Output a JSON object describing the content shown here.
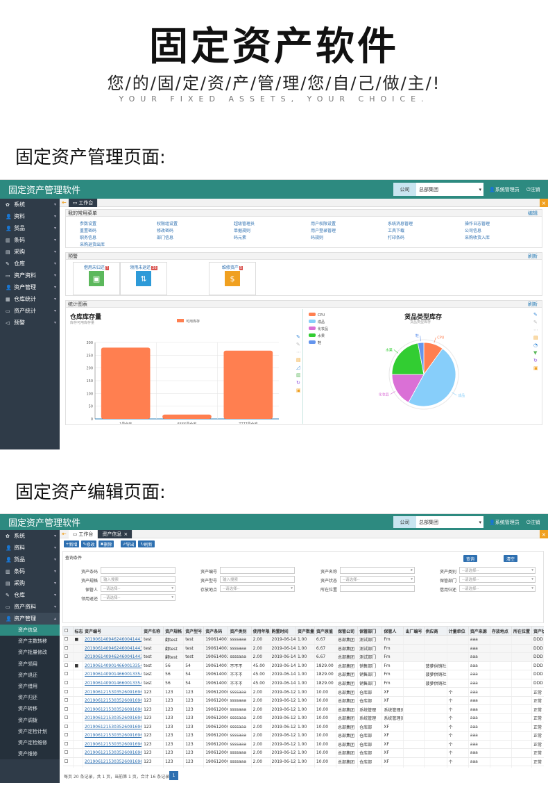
{
  "hero": {
    "title": "固定资产软件",
    "subtitle": "您/的/固/定/资/产/管/理/您/自/己/做/主/!",
    "english": "YOUR FIXED ASSETS, YOUR CHOICE."
  },
  "section1_label": "固定资产管理页面:",
  "section2_label": "固定资产编辑页面:",
  "app": {
    "title": "固定资产管理软件",
    "company_label": "公司",
    "company_value": "总部集团",
    "user": "系统管理员",
    "logout": "注销"
  },
  "sidebar1": [
    {
      "label": "系统",
      "icon": "gear-icon"
    },
    {
      "label": "资料",
      "icon": "user-icon"
    },
    {
      "label": "货品",
      "icon": "user-icon"
    },
    {
      "label": "条码",
      "icon": "barcode-icon"
    },
    {
      "label": "采购",
      "icon": "cart-icon"
    },
    {
      "label": "仓库",
      "icon": "edit-icon"
    },
    {
      "label": "资产资料",
      "icon": "monitor-icon"
    },
    {
      "label": "资产管理",
      "icon": "user-icon"
    },
    {
      "label": "仓库统计",
      "icon": "box-icon"
    },
    {
      "label": "资产统计",
      "icon": "monitor-icon"
    },
    {
      "label": "预警",
      "icon": "speaker-icon"
    }
  ],
  "tabs1": [
    {
      "label": "工作台"
    }
  ],
  "shortcuts": {
    "header": "我的常用菜单",
    "edit": "编辑",
    "items": [
      "参数设置",
      "权限组设置",
      "超级管理员",
      "用户权限设置",
      "系统消息管理",
      "操作日志管理",
      "重置密码",
      "修改密码",
      "单据规则",
      "用户登录管理",
      "工具下载",
      "公司信息",
      "职务信息",
      "部门信息",
      "码元素",
      "码规则",
      "打印条码",
      "采购收货入库",
      "采购退货出库"
    ]
  },
  "warning": {
    "header": "预警",
    "refresh": "刷新",
    "cards": [
      {
        "label": "借用未归还",
        "count": "7",
        "color": "#5cb85c",
        "icon": "check-box-icon",
        "symbol": "▣"
      },
      {
        "label": "领用未退还",
        "count": "26",
        "color": "#2d9ad8",
        "icon": "transfer-icon",
        "symbol": "⇅"
      },
      {
        "label": "维修资产",
        "count": "5",
        "color": "#f0a020",
        "icon": "money-bag-icon",
        "symbol": "$"
      }
    ]
  },
  "stats": {
    "header": "统计图表",
    "refresh": "刷新"
  },
  "chart_data": [
    {
      "type": "bar",
      "title": "仓库库存量",
      "subtitle": "库存可用库存量",
      "legend": "可用库存",
      "categories": [
        "1号仓库",
        "6666号仓库",
        "7777号仓库"
      ],
      "values": [
        280,
        17,
        268
      ],
      "ylim": [
        0,
        300
      ],
      "yticks": [
        "300",
        "250",
        "200",
        "150",
        "100",
        "50",
        "0"
      ],
      "color": "#ff7f50"
    },
    {
      "type": "pie",
      "title": "货品类型库存",
      "subtitle": "货品类型库存",
      "slices": [
        {
          "name": "CPU",
          "value": 10,
          "color": "#ff7f50"
        },
        {
          "name": "成品",
          "value": 48,
          "color": "#87cefa"
        },
        {
          "name": "化妆品",
          "value": 17,
          "color": "#da70d6"
        },
        {
          "name": "水果",
          "value": 22,
          "color": "#32cd32"
        },
        {
          "name": "鞋",
          "value": 3,
          "color": "#6495ed"
        }
      ]
    }
  ],
  "tabs2": [
    {
      "label": "工作台"
    },
    {
      "label": "资产信息"
    }
  ],
  "sidebar2": {
    "top": [
      {
        "label": "系统",
        "icon": "gear-icon"
      },
      {
        "label": "资料",
        "icon": "user-icon"
      },
      {
        "label": "货品",
        "icon": "user-icon"
      },
      {
        "label": "条码",
        "icon": "barcode-icon"
      },
      {
        "label": "采购",
        "icon": "cart-icon"
      },
      {
        "label": "仓库",
        "icon": "edit-icon"
      },
      {
        "label": "资产资料",
        "icon": "monitor-icon"
      },
      {
        "label": "资产管理",
        "icon": "user-icon"
      }
    ],
    "sub": [
      "资产信息",
      "资产主数转移",
      "资产批量修改",
      "资产领用",
      "资产退还",
      "资产借用",
      "资产归还",
      "资产转移",
      "资产调拨",
      "资产定检计划",
      "资产定检维修",
      "资产维修"
    ]
  },
  "toolbar": {
    "add": "新增",
    "edit": "修改",
    "delete": "删除",
    "export": "导出",
    "refresh": "刷新"
  },
  "query": {
    "title": "查询条件",
    "search_btn": "查询",
    "clear_btn": "清空",
    "fields": [
      {
        "label": "资产条码",
        "value": ""
      },
      {
        "label": "资产编号",
        "value": ""
      },
      {
        "label": "资产名称",
        "value": ""
      },
      {
        "label": "资产类别",
        "value": "--请选择--"
      },
      {
        "label": "资产规格",
        "value": "输入搜索"
      },
      {
        "label": "资产型号",
        "value": "输入搜索"
      },
      {
        "label": "资产状态",
        "value": "--请选择--"
      },
      {
        "label": "保管部门",
        "value": "--请选择--"
      },
      {
        "label": "保管人",
        "value": "--请选择--"
      },
      {
        "label": "存放地点",
        "value": "--请选择--"
      },
      {
        "label": "所在位置",
        "value": ""
      },
      {
        "label": "借用归还",
        "value": "--请选择--"
      },
      {
        "label": "领用退还",
        "value": "--请选择--"
      }
    ]
  },
  "table": {
    "headers": [
      "标志",
      "资产编号",
      "资产名称",
      "资产规格",
      "资产型号",
      "资产条码",
      "资产类别",
      "使用年限",
      "购置时间",
      "资产数量",
      "资产原值",
      "保管公司",
      "保管部门",
      "保管人",
      "出厂编号",
      "供应商",
      "计量单位",
      "资产来源",
      "存放地点",
      "所在位置",
      "资产状"
    ],
    "rows": [
      [
        "■",
        "20190614094624600414​43J",
        "test",
        "翻test",
        "test",
        "1906140019",
        "ssssaaa",
        "2.00",
        "2019-06-14",
        "1.00",
        "6.67",
        "总部集团",
        "测试部门",
        "Fm",
        "",
        "",
        "",
        "aaa",
        "",
        "",
        "DDD"
      ],
      [
        "",
        "201906140946246004144​3J",
        "test",
        "翻test",
        "test",
        "1906140020",
        "ssssaaa",
        "2.00",
        "2019-06-14",
        "1.00",
        "6.67",
        "总部集团",
        "测试部门",
        "Fm",
        "",
        "",
        "",
        "aaa",
        "",
        "",
        "DDD"
      ],
      [
        "",
        "201906140946246004144​3J",
        "test",
        "翻test",
        "test",
        "1906140021",
        "ssssaaa",
        "2.00",
        "2019-06-14",
        "1.00",
        "6.67",
        "总部集团",
        "测试部门",
        "Fm",
        "",
        "",
        "",
        "aaa",
        "",
        "",
        "DDD"
      ],
      [
        "■",
        "20190614090146600133​54G",
        "test",
        "56",
        "54",
        "1906140015",
        "不不不",
        "45.00",
        "2019-06-14",
        "1.00",
        "1829.00",
        "总部集团",
        "销售部门",
        "Fm",
        "",
        "菠萝供销社",
        "",
        "aaa",
        "",
        "",
        "DDD"
      ],
      [
        "",
        "20190614090146600133​54G",
        "test",
        "56",
        "54",
        "1906140016",
        "不不不",
        "45.00",
        "2019-06-14",
        "1.00",
        "1829.00",
        "总部集团",
        "销售部门",
        "Fm",
        "",
        "菠萝供销社",
        "",
        "aaa",
        "",
        "",
        "DDD"
      ],
      [
        "",
        "20190614090146600133​54G",
        "test",
        "56",
        "54",
        "1906140017",
        "不不不",
        "45.00",
        "2019-06-14",
        "1.00",
        "1829.00",
        "总部集团",
        "销售部门",
        "Fm",
        "",
        "菠萝供销社",
        "",
        "aaa",
        "",
        "",
        "DDD"
      ],
      [
        "",
        "20190612153035260916​96G",
        "123",
        "123",
        "123",
        "1906120001",
        "ssssaaa",
        "2.00",
        "2019-06-12",
        "1.00",
        "10.00",
        "总部集团",
        "仓库部",
        "XF",
        "",
        "",
        "个",
        "aaa",
        "",
        "",
        "正常"
      ],
      [
        "",
        "20190612153035260916​96G",
        "123",
        "123",
        "123",
        "1906120002",
        "ssssaaa",
        "2.00",
        "2019-06-12",
        "1.00",
        "10.00",
        "总部集团",
        "仓库部",
        "XF",
        "",
        "",
        "个",
        "aaa",
        "",
        "",
        "正常"
      ],
      [
        "",
        "20190612153035260916​96G",
        "123",
        "123",
        "123",
        "1906120003",
        "ssssaaa",
        "2.00",
        "2019-06-12",
        "1.00",
        "10.00",
        "总部集团",
        "系统管理",
        "系统管理员",
        "",
        "",
        "个",
        "aaa",
        "",
        "",
        "正常"
      ],
      [
        "",
        "20190612153035260916​96G",
        "123",
        "123",
        "123",
        "1906120004",
        "ssssaaa",
        "2.00",
        "2019-06-12",
        "1.00",
        "10.00",
        "总部集团",
        "系统管理",
        "系统管理员",
        "",
        "",
        "个",
        "aaa",
        "",
        "",
        "正常"
      ],
      [
        "",
        "20190612153035260916​96G",
        "123",
        "123",
        "123",
        "1906120005",
        "ssssaaa",
        "2.00",
        "2019-06-12",
        "1.00",
        "10.00",
        "总部集团",
        "仓库部",
        "XF",
        "",
        "",
        "个",
        "aaa",
        "",
        "",
        "正常"
      ],
      [
        "",
        "20190612153035260916​96G",
        "123",
        "123",
        "123",
        "1906120006",
        "ssssaaa",
        "2.00",
        "2019-06-12",
        "1.00",
        "10.00",
        "总部集团",
        "仓库部",
        "XF",
        "",
        "",
        "个",
        "aaa",
        "",
        "",
        "正常"
      ],
      [
        "",
        "20190612153035260916​96G",
        "123",
        "123",
        "123",
        "1906120007",
        "ssssaaa",
        "2.00",
        "2019-06-12",
        "1.00",
        "10.00",
        "总部集团",
        "仓库部",
        "XF",
        "",
        "",
        "个",
        "aaa",
        "",
        "",
        "正常"
      ],
      [
        "",
        "20190612153035260916​96G",
        "123",
        "123",
        "123",
        "1906120008",
        "ssssaaa",
        "2.00",
        "2019-06-12",
        "1.00",
        "10.00",
        "总部集团",
        "仓库部",
        "XF",
        "",
        "",
        "个",
        "aaa",
        "",
        "",
        "正常"
      ],
      [
        "",
        "20190612153035260916​96G",
        "123",
        "123",
        "123",
        "1906120009",
        "ssssaaa",
        "2.00",
        "2019-06-12",
        "1.00",
        "10.00",
        "总部集团",
        "仓库部",
        "XF",
        "",
        "",
        "个",
        "aaa",
        "",
        "",
        "正常"
      ],
      [
        "",
        "20190612153035260916​96G",
        "123",
        "123",
        "123",
        "1906120010",
        "ssssaaa",
        "2.00",
        "2019-06-12",
        "1.00",
        "10.00",
        "总部集团",
        "仓库部",
        "XF",
        "",
        "",
        "个",
        "aaa",
        "",
        "",
        "正常"
      ]
    ]
  },
  "pager": {
    "text": "每页 20 条记录，共 1 页，当前第 1 页，合计 16 条记录",
    "page": "1"
  }
}
